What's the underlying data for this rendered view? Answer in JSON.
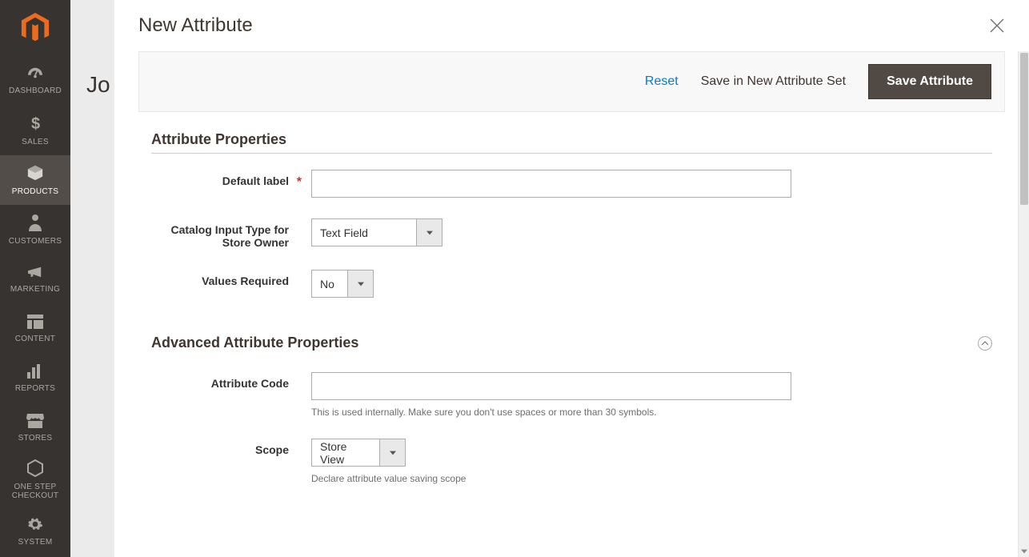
{
  "sidebar": {
    "items": [
      {
        "label": "DASHBOARD",
        "icon": "dashboard-icon"
      },
      {
        "label": "SALES",
        "icon": "dollar-icon"
      },
      {
        "label": "PRODUCTS",
        "icon": "cube-icon",
        "active": true
      },
      {
        "label": "CUSTOMERS",
        "icon": "person-icon"
      },
      {
        "label": "MARKETING",
        "icon": "megaphone-icon"
      },
      {
        "label": "CONTENT",
        "icon": "layout-icon"
      },
      {
        "label": "REPORTS",
        "icon": "bar-chart-icon"
      },
      {
        "label": "STORES",
        "icon": "storefront-icon"
      },
      {
        "label": "ONE STEP CHECKOUT",
        "icon": "hexagon-icon"
      },
      {
        "label": "SYSTEM",
        "icon": "gear-icon"
      }
    ]
  },
  "background_page": {
    "title_partial": "Jo"
  },
  "modal": {
    "title": "New Attribute",
    "actions": {
      "reset": "Reset",
      "save_set": "Save in New Attribute Set",
      "save": "Save Attribute"
    },
    "sections": {
      "props": {
        "title": "Attribute Properties",
        "fields": {
          "default_label": {
            "label": "Default label",
            "value": ""
          },
          "input_type": {
            "label": "Catalog Input Type for Store Owner",
            "value": "Text Field"
          },
          "values_required": {
            "label": "Values Required",
            "value": "No"
          }
        }
      },
      "advanced": {
        "title": "Advanced Attribute Properties",
        "fields": {
          "attribute_code": {
            "label": "Attribute Code",
            "value": "",
            "helper": "This is used internally. Make sure you don't use spaces or more than 30 symbols."
          },
          "scope": {
            "label": "Scope",
            "value": "Store View",
            "helper": "Declare attribute value saving scope"
          }
        }
      }
    }
  }
}
